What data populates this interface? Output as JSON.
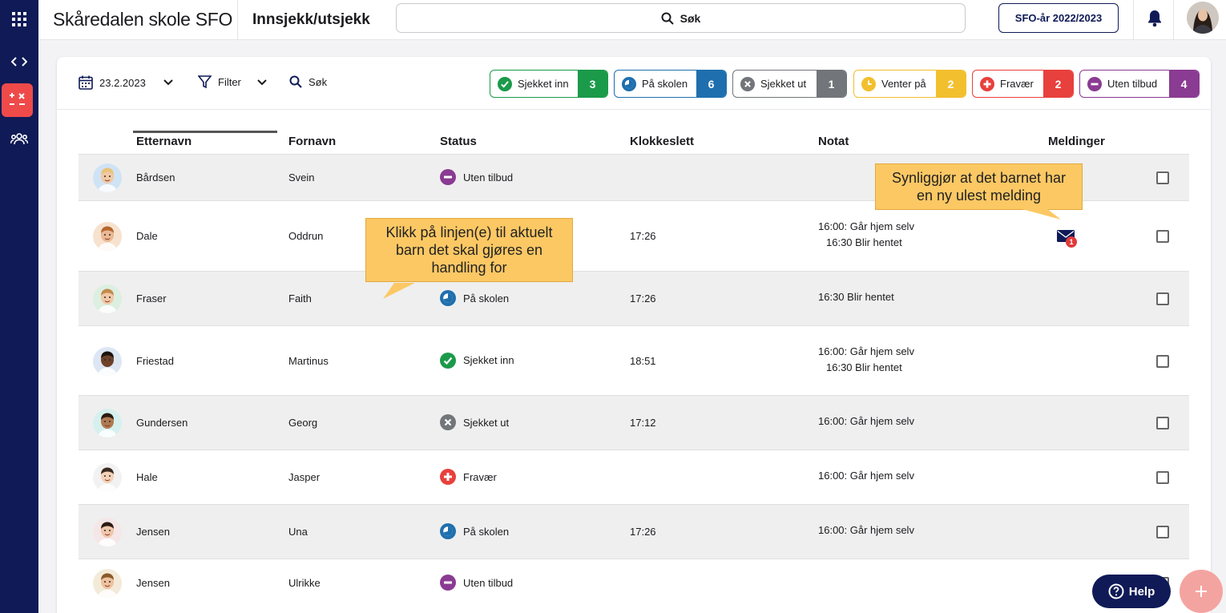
{
  "header": {
    "school_name": "Skåredalen skole SFO",
    "page_title": "Innsjekk/utsjekk",
    "search_label": "Søk",
    "year_button": "SFO-år 2022/2023"
  },
  "sidebar": {
    "items": [
      {
        "icon": "apps-grid-icon"
      },
      {
        "icon": "code-brackets-icon"
      },
      {
        "icon": "checklist-icon",
        "active": true
      },
      {
        "icon": "users-group-icon"
      }
    ]
  },
  "toolbar": {
    "date": "23.2.2023",
    "filter_label": "Filter",
    "search_label": "Søk"
  },
  "status_chips": [
    {
      "label": "Sjekket inn",
      "count": "3",
      "color": "#1b9a4a"
    },
    {
      "label": "På skolen",
      "count": "6",
      "color": "#1f6fae"
    },
    {
      "label": "Sjekket ut",
      "count": "1",
      "color": "#727579"
    },
    {
      "label": "Venter på",
      "count": "2",
      "color": "#f2bf2f"
    },
    {
      "label": "Fravær",
      "count": "2",
      "color": "#e8403c"
    },
    {
      "label": "Uten tilbud",
      "count": "4",
      "color": "#8a3b92"
    }
  ],
  "table": {
    "columns": [
      "Etternavn",
      "Fornavn",
      "Status",
      "Klokkeslett",
      "Notat",
      "Meldinger"
    ],
    "rows": [
      {
        "last": "Bårdsen",
        "first": "Svein",
        "status": "Uten tilbud",
        "time": "",
        "notes": [],
        "unread": ""
      },
      {
        "last": "Dale",
        "first": "Oddrun",
        "status": "",
        "time": "17:26",
        "notes": [
          "16:00: Går hjem selv",
          "16:30 Blir hentet"
        ],
        "unread": "1"
      },
      {
        "last": "Fraser",
        "first": "Faith",
        "status": "På skolen",
        "time": "17:26",
        "notes": [
          "16:30 Blir hentet"
        ],
        "unread": ""
      },
      {
        "last": "Friestad",
        "first": "Martinus",
        "status": "Sjekket inn",
        "time": "18:51",
        "notes": [
          "16:00: Går hjem selv",
          "16:30 Blir hentet"
        ],
        "unread": ""
      },
      {
        "last": "Gundersen",
        "first": "Georg",
        "status": "Sjekket ut",
        "time": "17:12",
        "notes": [
          "16:00: Går hjem selv"
        ],
        "unread": ""
      },
      {
        "last": "Hale",
        "first": "Jasper",
        "status": "Fravær",
        "time": "",
        "notes": [
          "16:00: Går hjem selv"
        ],
        "unread": ""
      },
      {
        "last": "Jensen",
        "first": "Una",
        "status": "På skolen",
        "time": "17:26",
        "notes": [
          "16:00: Går hjem selv"
        ],
        "unread": ""
      },
      {
        "last": "Jensen",
        "first": "Ulrikke",
        "status": "Uten tilbud",
        "time": "",
        "notes": [],
        "unread": ""
      }
    ]
  },
  "callouts": {
    "rows_hint": "Klikk på linjen(e) til aktuelt barn det skal gjøres en handling for",
    "message_hint": "Synliggjør at det barnet har en ny ulest melding"
  },
  "help_label": "Help"
}
